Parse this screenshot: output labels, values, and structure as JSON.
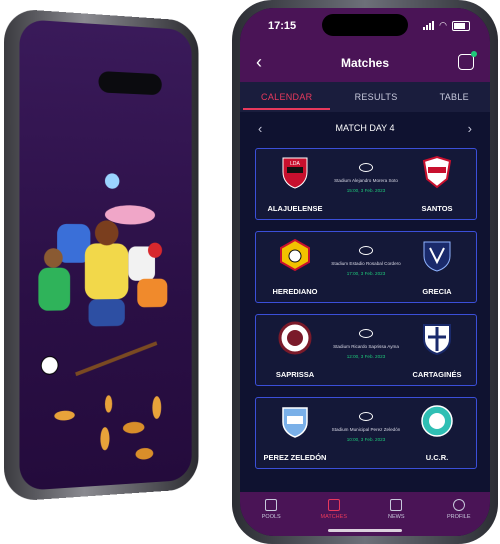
{
  "status_bar": {
    "time": "17:15"
  },
  "header": {
    "title": "Matches"
  },
  "tabs": [
    {
      "label": "CALENDAR",
      "active": true
    },
    {
      "label": "RESULTS",
      "active": false
    },
    {
      "label": "TABLE",
      "active": false
    }
  ],
  "matchday": {
    "label": "MATCH DAY 4"
  },
  "matches": [
    {
      "home": "ALAJUELENSE",
      "away": "SANTOS",
      "stadium": "Stadium Alejandro Morera Soto",
      "datetime": "15:00, 3 Feb. 2023"
    },
    {
      "home": "HEREDIANO",
      "away": "GRECIA",
      "stadium": "Stadium Estadio Rosabal Cordero",
      "datetime": "17:00, 3 Feb. 2023"
    },
    {
      "home": "SAPRISSA",
      "away": "CARTAGINÉS",
      "stadium": "Stadium Ricardo Saprissa Ayma",
      "datetime": "12:00, 3 Feb. 2023"
    },
    {
      "home": "PEREZ ZELEDÓN",
      "away": "U.C.R.",
      "stadium": "Stadium Municipal Perez Zeledón",
      "datetime": "10:00, 3 Feb. 2023"
    }
  ],
  "bottom_nav": [
    {
      "label": "POOLS",
      "icon": "trophy-icon",
      "active": false
    },
    {
      "label": "MATCHES",
      "icon": "calendar-icon",
      "active": true
    },
    {
      "label": "NEWS",
      "icon": "news-icon",
      "active": false
    },
    {
      "label": "PROFILE",
      "icon": "profile-icon",
      "active": false
    }
  ],
  "colors": {
    "brand_purple": "#4a1456",
    "accent_red": "#e8395c",
    "card_border": "#3b4fd9",
    "time_green": "#1ec97a",
    "screen_bg": "#0f1230"
  }
}
